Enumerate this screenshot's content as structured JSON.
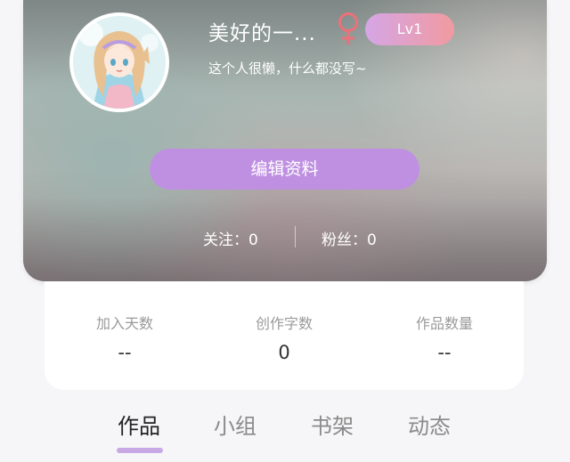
{
  "profile": {
    "nickname": "美好的一...",
    "gender_icon": "female-icon",
    "gender_color": "#e8727a",
    "level": "Lv1",
    "bio": "这个人很懒，什么都没写~",
    "edit_label": "编辑资料",
    "following": "关注：0",
    "fans": "粉丝：0"
  },
  "stats": [
    {
      "label": "加入天数",
      "value": "--"
    },
    {
      "label": "创作字数",
      "value": "0"
    },
    {
      "label": "作品数量",
      "value": "--"
    }
  ],
  "tabs": [
    {
      "label": "作品",
      "active": true
    },
    {
      "label": "小组",
      "active": false
    },
    {
      "label": "书架",
      "active": false
    },
    {
      "label": "动态",
      "active": false
    }
  ],
  "colors": {
    "accent": "#bf90e1",
    "tab_indicator": "#c9a8e6",
    "badge_start": "#d5a6e6",
    "badge_end": "#f19aa0"
  }
}
